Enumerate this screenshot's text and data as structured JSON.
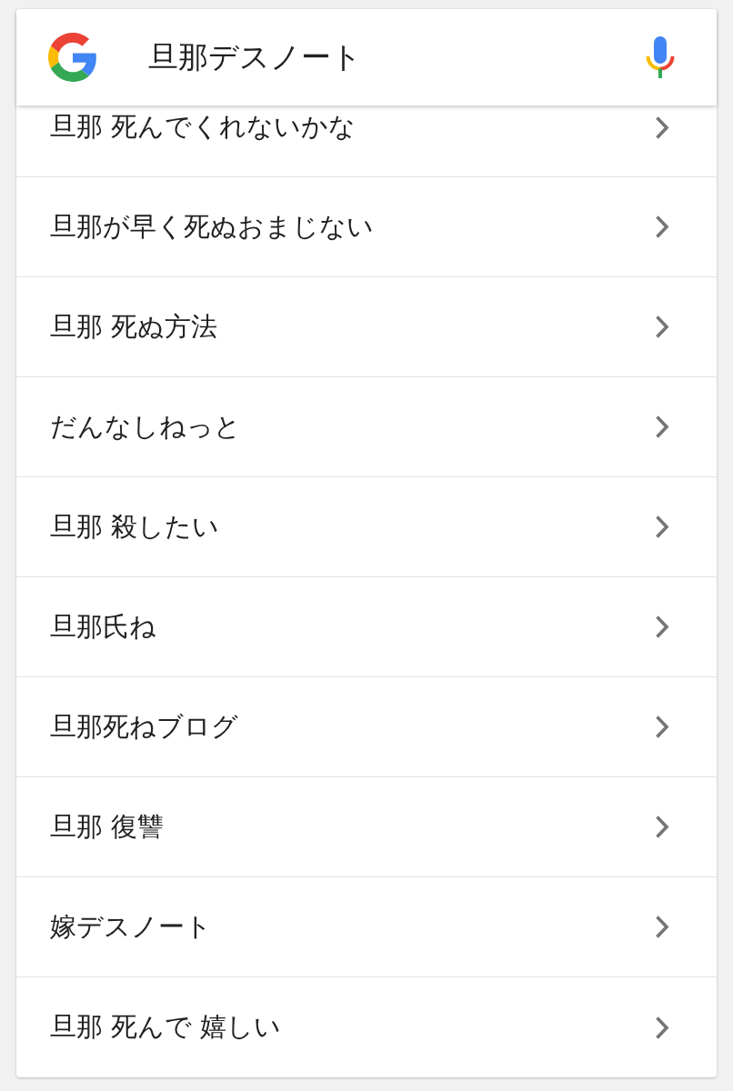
{
  "search_bar": {
    "query": "旦那デスノート"
  },
  "suggestions": [
    {
      "text": "旦那 死んでくれないかな"
    },
    {
      "text": "旦那が早く死ぬおまじない"
    },
    {
      "text": "旦那 死ぬ方法"
    },
    {
      "text": "だんなしねっと"
    },
    {
      "text": "旦那 殺したい"
    },
    {
      "text": "旦那氏ね"
    },
    {
      "text": "旦那死ねブログ"
    },
    {
      "text": "旦那 復讐"
    },
    {
      "text": "嫁デスノート"
    },
    {
      "text": "旦那 死んで 嬉しい"
    }
  ]
}
